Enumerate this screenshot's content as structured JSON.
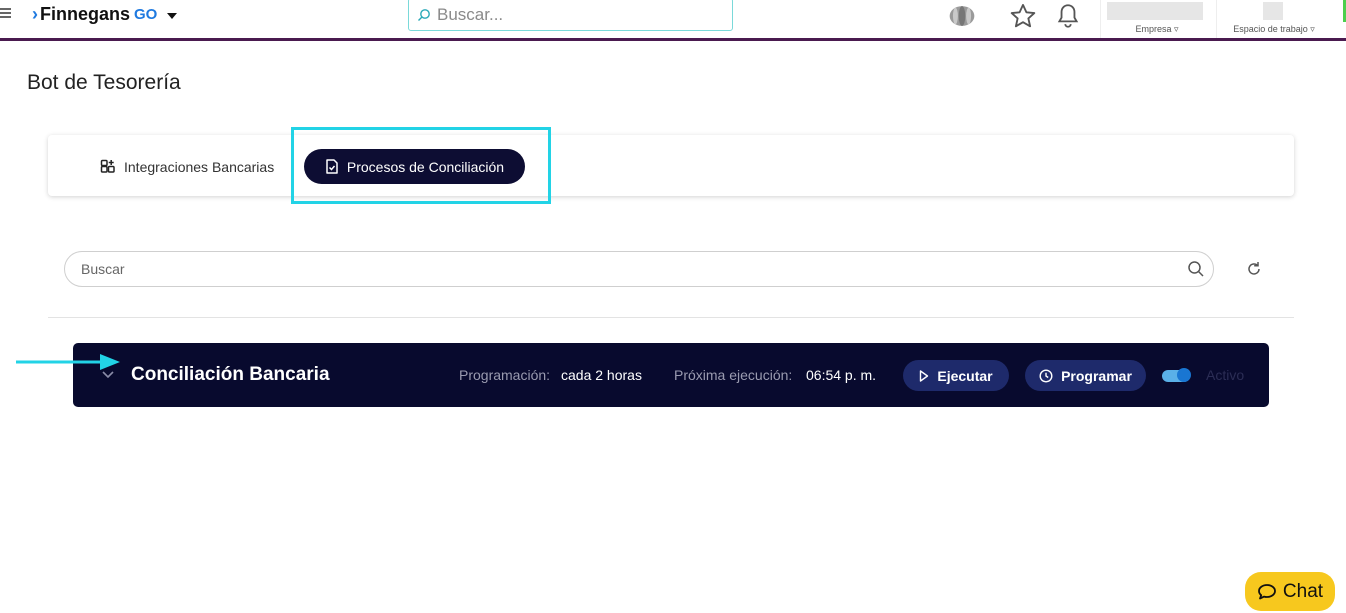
{
  "header": {
    "logo_text": "Finnegans",
    "logo_suffix": "GO",
    "search_placeholder": "Buscar...",
    "company_label": "Empresa ▿",
    "workspace_label": "Espacio de trabajo ▿"
  },
  "page": {
    "title": "Bot de Tesorería"
  },
  "tabs": [
    {
      "label": "Integraciones Bancarias",
      "icon": "grid-plus-icon",
      "active": false
    },
    {
      "label": "Procesos de Conciliación",
      "icon": "document-check-icon",
      "active": true
    }
  ],
  "search": {
    "placeholder": "Buscar"
  },
  "process": {
    "name": "Conciliación Bancaria",
    "schedule_label": "Programación:",
    "schedule_value": "cada 2 horas",
    "next_label": "Próxima ejecución:",
    "next_value": "06:54 p. m.",
    "run_label": "Ejecutar",
    "schedule_button_label": "Programar",
    "status_label": "Activo",
    "enabled": true
  },
  "chat": {
    "label": "Chat"
  },
  "colors": {
    "header_line": "#4a1a4f",
    "primary_dark": "#0d0d33",
    "highlight": "#22d3e6",
    "button_blue": "#1e2a6b",
    "chat_yellow": "#f7c81e"
  }
}
